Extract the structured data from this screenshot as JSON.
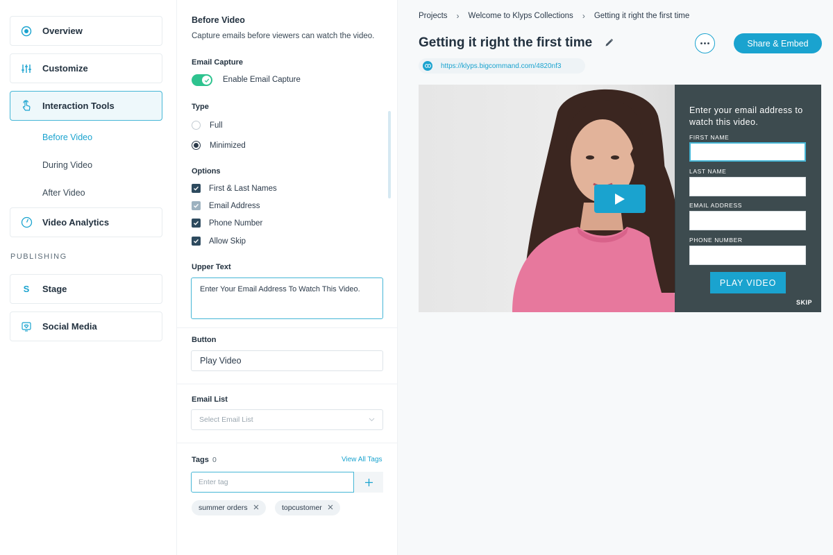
{
  "nav": {
    "overview": "Overview",
    "customize": "Customize",
    "interaction_tools": "Interaction Tools",
    "sub": [
      "Before Video",
      "During Video",
      "After Video"
    ],
    "video_analytics": "Video Analytics",
    "publishing_label": "PUBLISHING",
    "stage_letter": "S",
    "stage": "Stage",
    "social_media": "Social Media"
  },
  "panel": {
    "title": "Before Video",
    "description": "Capture emails before viewers can watch the video.",
    "email_capture_label": "Email Capture",
    "enable_label": "Enable Email Capture",
    "type_label": "Type",
    "type_options": [
      "Full",
      "Minimized"
    ],
    "type_selected": "Minimized",
    "options_label": "Options",
    "options": [
      "First & Last Names",
      "Email Address",
      "Phone Number",
      "Allow Skip"
    ],
    "upper_text_label": "Upper Text",
    "upper_text_value": "Enter Your Email Address To Watch This Video.",
    "button_label": "Button",
    "button_value": "Play Video",
    "email_list_label": "Email List",
    "email_list_placeholder": "Select Email List",
    "tags_label": "Tags",
    "tags_count": "0",
    "view_all_tags": "View All Tags",
    "tag_placeholder": "Enter tag",
    "tags": [
      "summer orders",
      "topcustomer"
    ]
  },
  "main": {
    "breadcrumbs": [
      "Projects",
      "Welcome to Klyps Collections",
      "Getting it right the first time"
    ],
    "title": "Getting it right the first time",
    "share_button": "Share & Embed",
    "link": "https://klyps.bigcommand.com/4820nf3",
    "accent_color": "#1aa3cf"
  },
  "player": {
    "heading": "Enter your email address to watch this video.",
    "fields": [
      "FIRST NAME",
      "LAST NAME",
      "EMAIL ADDRESS",
      "PHONE NUMBER"
    ],
    "play_button": "PLAY VIDEO",
    "skip": "SKIP"
  }
}
